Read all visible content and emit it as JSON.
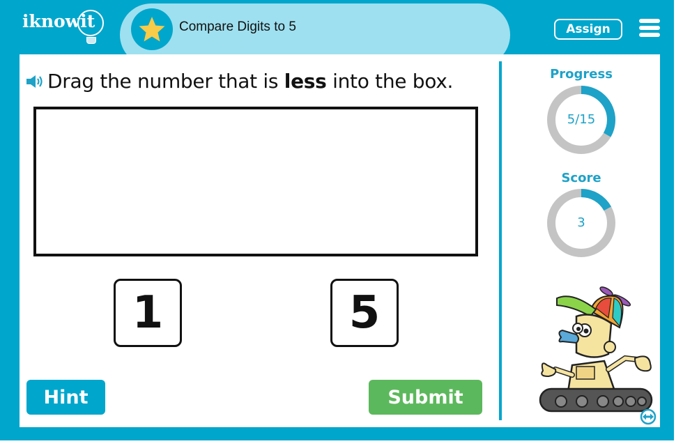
{
  "header": {
    "logo_text": "iknowit",
    "lesson_icon": "star-icon",
    "lesson_title": "Compare Digits to 5",
    "assign_label": "Assign",
    "menu_icon": "hamburger-menu-icon"
  },
  "question": {
    "audio_icon": "speaker-icon",
    "prefix": "Drag the number that is ",
    "emphasis": "less",
    "suffix": " into the box."
  },
  "drop_box": {
    "contents": ""
  },
  "choices": [
    {
      "value": "1"
    },
    {
      "value": "5"
    }
  ],
  "buttons": {
    "hint_label": "Hint",
    "submit_label": "Submit"
  },
  "sidebar": {
    "progress_label": "Progress",
    "progress_text": "5/15",
    "progress_current": 5,
    "progress_total": 15,
    "score_label": "Score",
    "score_text": "3",
    "score_fraction": 0.17,
    "mascot": "robot-mascot-propeller-cap",
    "toggle_icon": "swap-arrows-icon"
  },
  "colors": {
    "brand_blue": "#00a6cc",
    "header_light": "#9ee0ef",
    "star": "#f8cb48",
    "submit_green": "#5cb85c",
    "ring_track": "#c4c4c4",
    "ring_fill": "#1ea2c8"
  }
}
